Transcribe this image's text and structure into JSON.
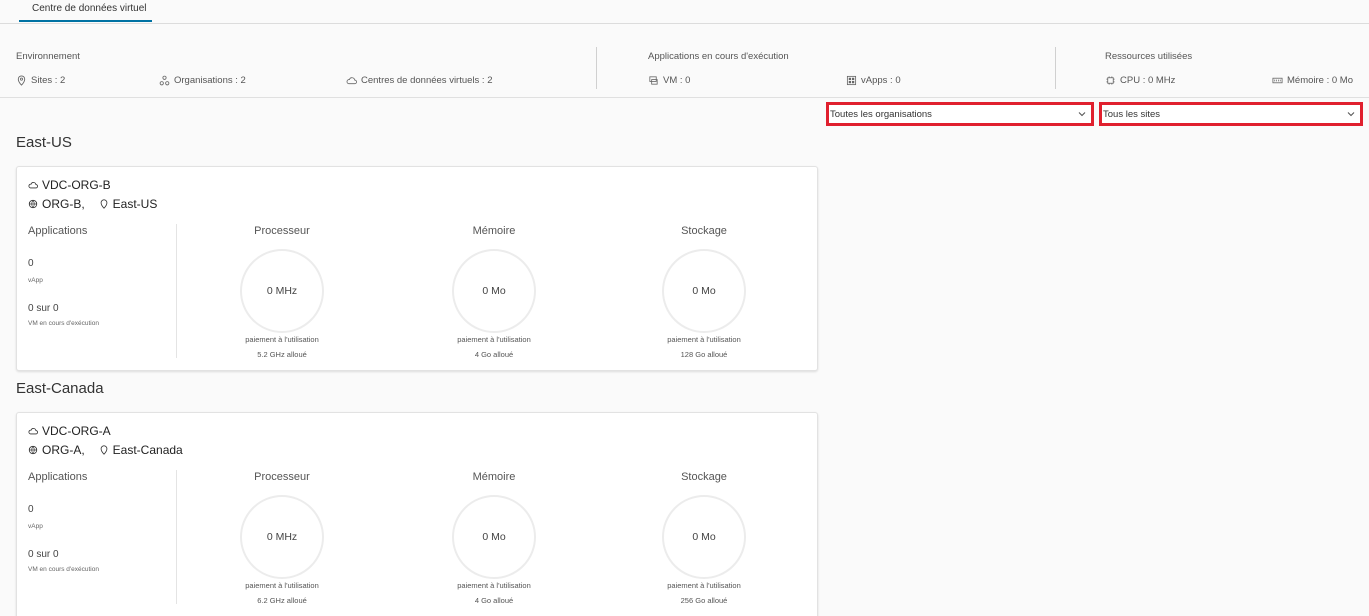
{
  "tabs": [
    {
      "label": "Centre de données virtuel"
    }
  ],
  "summary": {
    "environment": {
      "title": "Environnement",
      "sites": "Sites : 2",
      "organizations": "Organisations : 2",
      "vdcs": "Centres de données virtuels : 2"
    },
    "running_apps": {
      "title": "Applications en cours d'exécution",
      "vm": "VM : 0",
      "vapps": "vApps : 0"
    },
    "resources": {
      "title": "Ressources utilisées",
      "cpu": "CPU : 0 MHz",
      "memory": "Mémoire : 0 Mo"
    }
  },
  "filters": {
    "organizations": "Toutes les organisations",
    "sites": "Tous les sites"
  },
  "regions": [
    {
      "name": "East-US",
      "card": {
        "vdc_name": "VDC-ORG-B",
        "org": "ORG-B,",
        "site": "East-US",
        "apps_title": "Applications",
        "vapp_count": "0",
        "vapp_label": "vApp",
        "vm_count": "0 sur 0",
        "vm_label": "VM en cours d'exécution",
        "metrics": [
          {
            "title": "Processeur",
            "value": "0 MHz",
            "model": "paiement à l'utilisation",
            "allocated": "5.2 GHz alloué"
          },
          {
            "title": "Mémoire",
            "value": "0 Mo",
            "model": "paiement à l'utilisation",
            "allocated": "4 Go alloué"
          },
          {
            "title": "Stockage",
            "value": "0 Mo",
            "model": "paiement à l'utilisation",
            "allocated": "128 Go alloué"
          }
        ]
      }
    },
    {
      "name": "East-Canada",
      "card": {
        "vdc_name": "VDC-ORG-A",
        "org": "ORG-A,",
        "site": "East-Canada",
        "apps_title": "Applications",
        "vapp_count": "0",
        "vapp_label": "vApp",
        "vm_count": "0 sur 0",
        "vm_label": "VM en cours d'exécution",
        "metrics": [
          {
            "title": "Processeur",
            "value": "0 MHz",
            "model": "paiement à l'utilisation",
            "allocated": "6.2 GHz alloué"
          },
          {
            "title": "Mémoire",
            "value": "0 Mo",
            "model": "paiement à l'utilisation",
            "allocated": "4 Go alloué"
          },
          {
            "title": "Stockage",
            "value": "0 Mo",
            "model": "paiement à l'utilisation",
            "allocated": "256 Go alloué"
          }
        ]
      }
    }
  ],
  "colors": {
    "accent": "#0072a3",
    "highlight": "#e0202e"
  }
}
